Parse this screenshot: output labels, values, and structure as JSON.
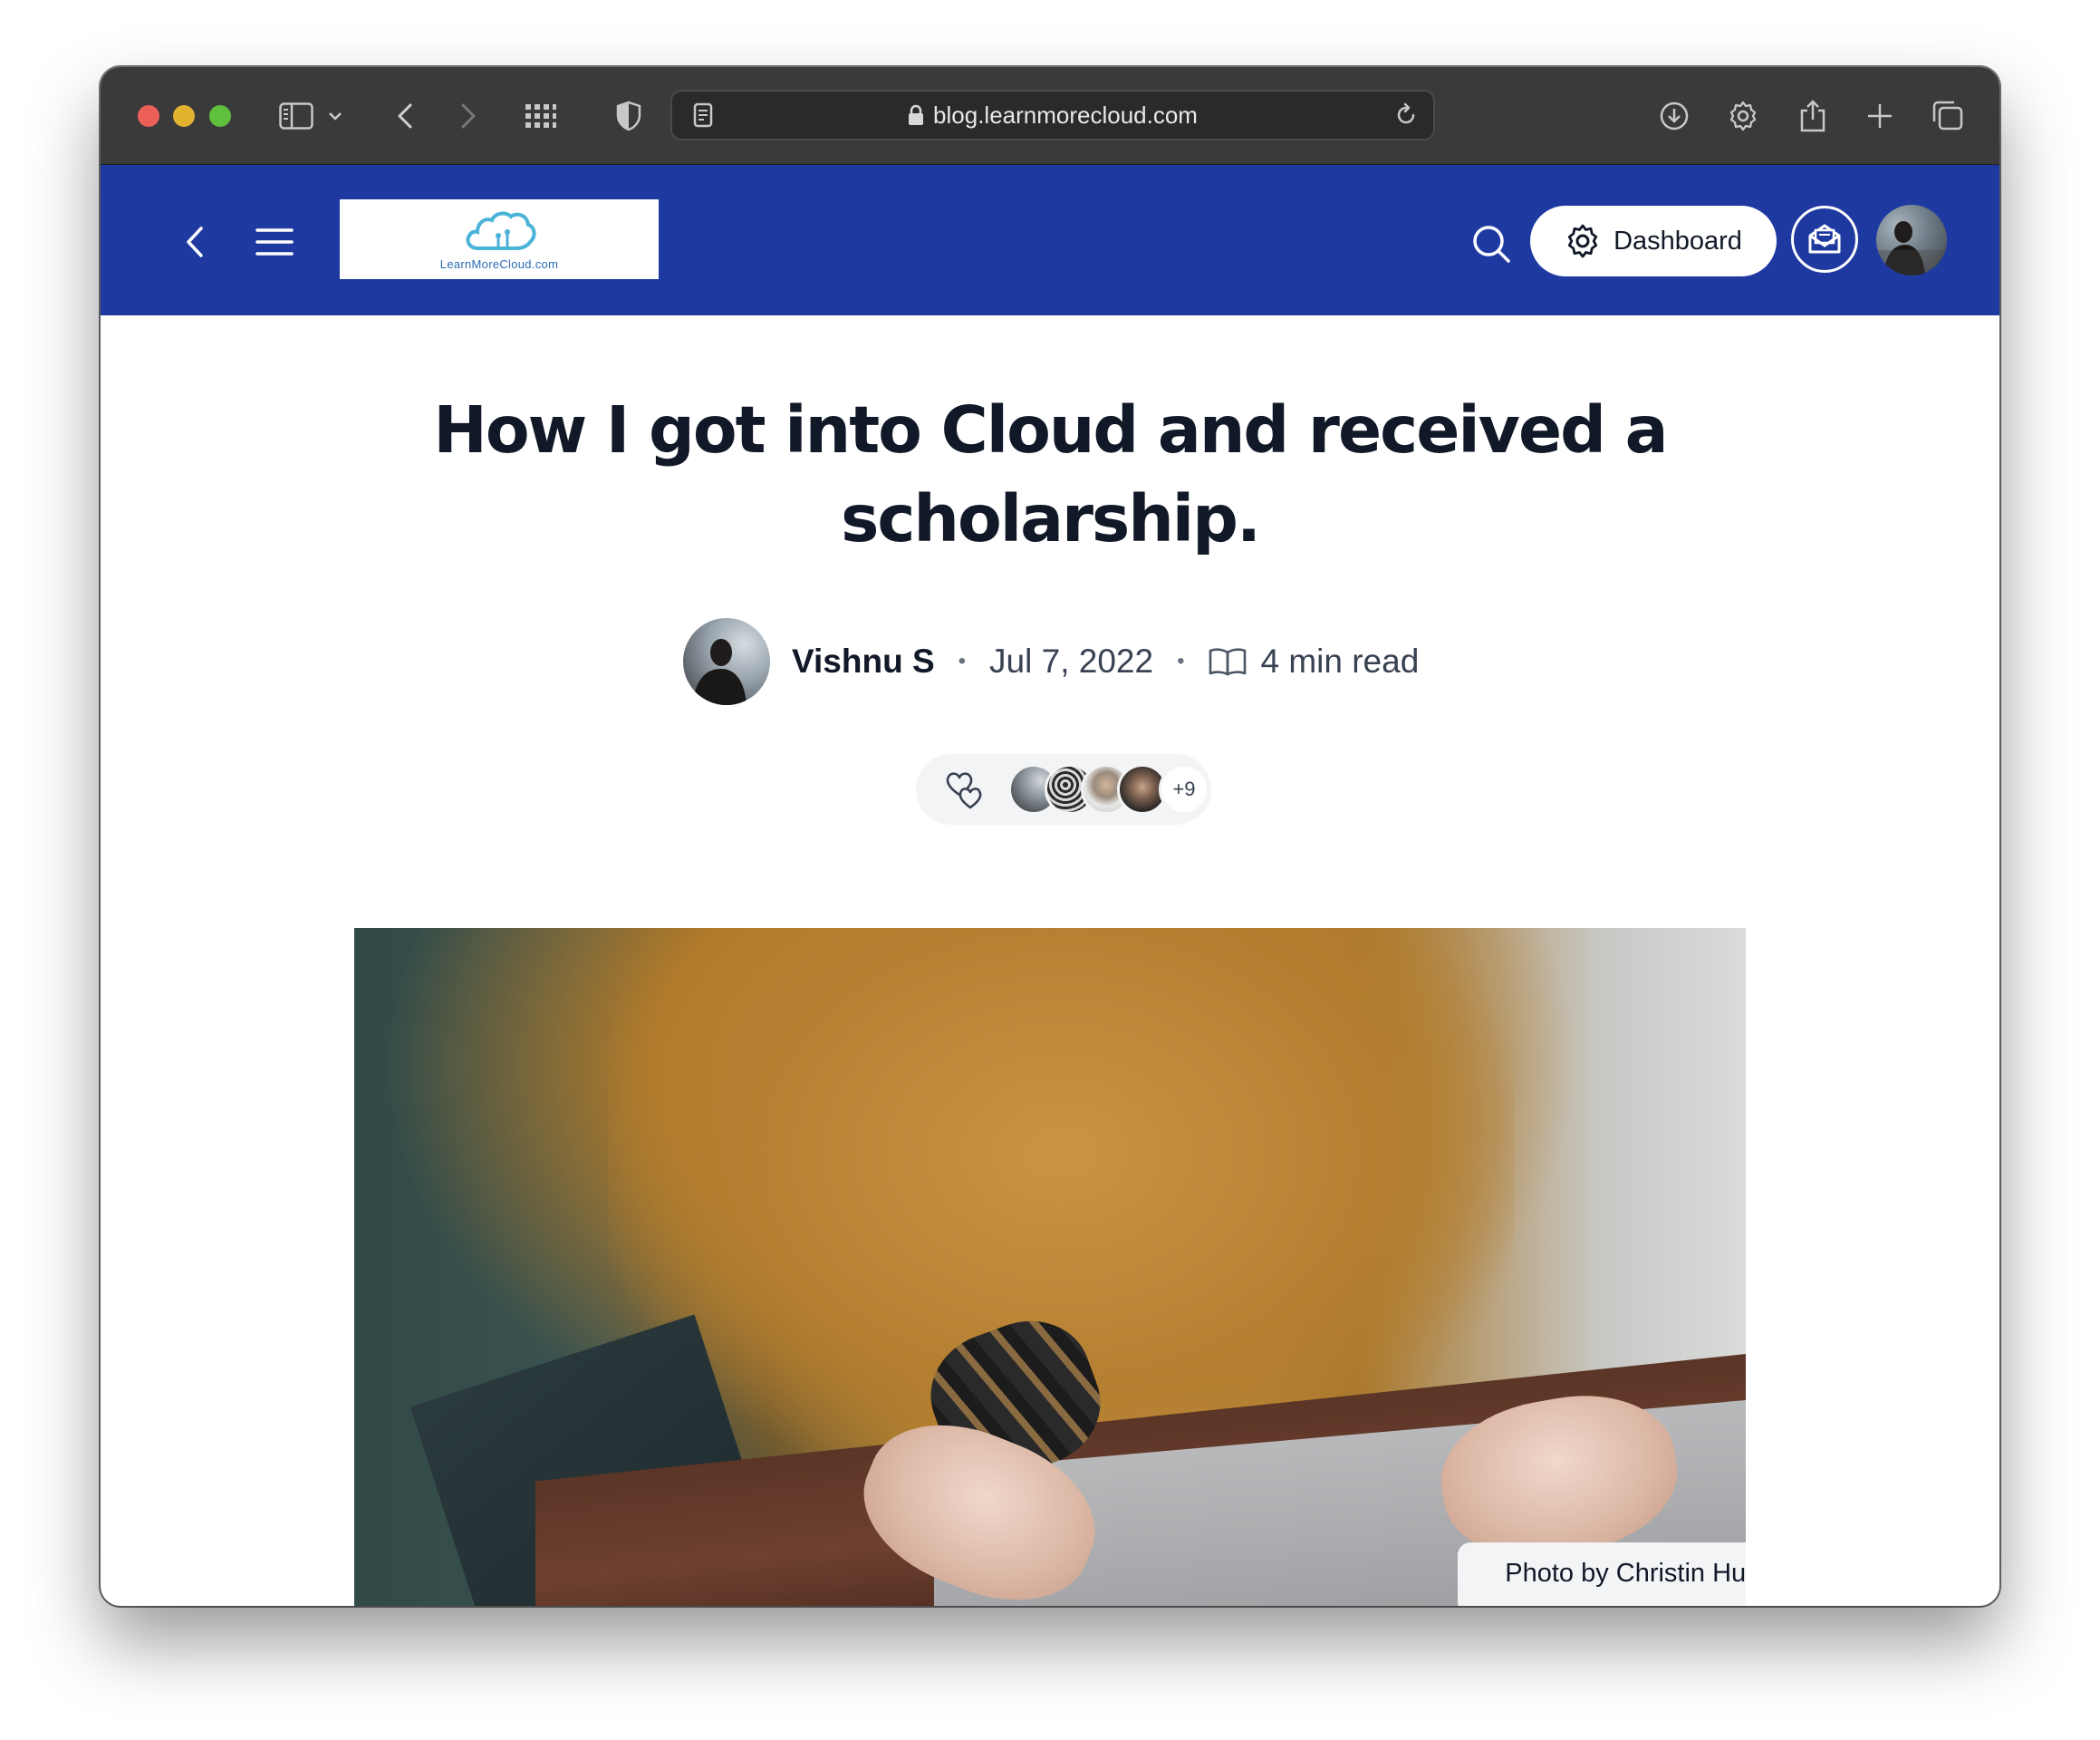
{
  "browser": {
    "url": "blog.learnmorecloud.com"
  },
  "header": {
    "logo_text": "LearnMoreCloud.com",
    "dashboard_label": "Dashboard"
  },
  "article": {
    "title": "How I got into Cloud and received a scholarship.",
    "author": "Vishnu S",
    "date": "Jul 7, 2022",
    "read_time": "4 min read",
    "separator": "•",
    "reactions": {
      "more_count": "+9"
    },
    "cover_caption": "Photo by Christin Hume on Unsplash"
  },
  "colors": {
    "header_bg": "#1e3aa1",
    "toolbar_bg": "#3a3a3b",
    "title_text": "#111827"
  },
  "icons": {
    "toolbar": [
      "sidebar-icon",
      "chevron-down-icon",
      "back-icon",
      "forward-icon",
      "tab-grid-icon",
      "shield-icon",
      "reader-icon",
      "lock-icon",
      "reload-icon",
      "download-icon",
      "gear-icon",
      "share-icon",
      "new-tab-icon",
      "tabs-overview-icon"
    ],
    "header": [
      "back-chevron-icon",
      "menu-icon",
      "search-icon",
      "moon-icon",
      "gear-icon",
      "newsletter-icon"
    ]
  }
}
